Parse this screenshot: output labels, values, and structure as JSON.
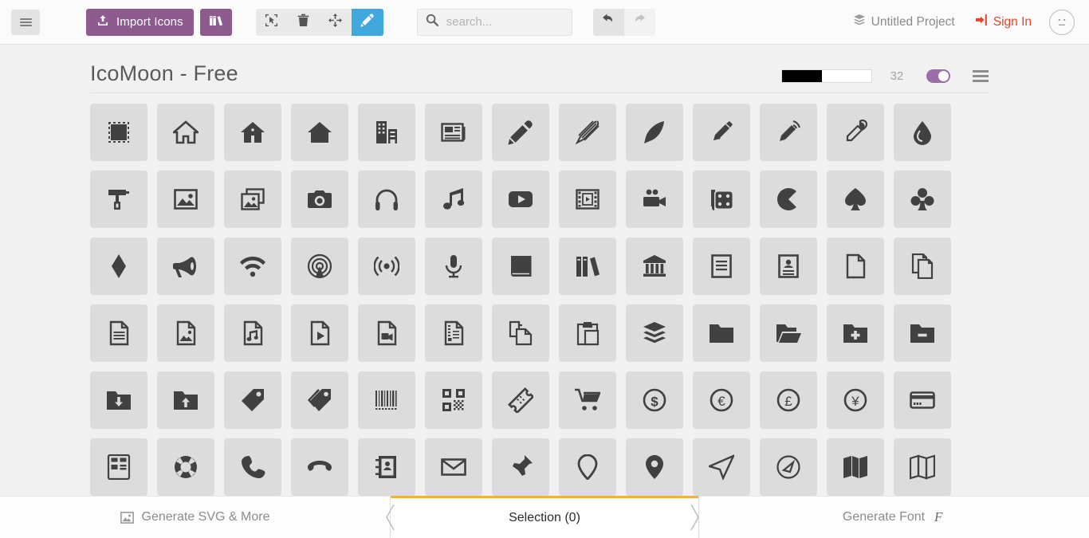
{
  "topbar": {
    "menu_button": "menu-icon",
    "import_label": "Import Icons",
    "library_label": "library-icon",
    "tools": [
      {
        "name": "select-tool",
        "icon": "cursor-select-icon",
        "active": false
      },
      {
        "name": "delete-tool",
        "icon": "trash-icon",
        "active": false
      },
      {
        "name": "move-tool",
        "icon": "move-icon",
        "active": false
      },
      {
        "name": "edit-tool",
        "icon": "pencil-icon",
        "active": true
      }
    ],
    "search": {
      "value": "",
      "placeholder": "search..."
    },
    "undo_label": "undo-icon",
    "redo_label": "redo-icon",
    "project_label": "Untitled Project",
    "signin_label": "Sign In",
    "avatar_label": "user-avatar"
  },
  "set": {
    "title": "IcoMoon - Free",
    "size_value": "32",
    "size_percent": 45,
    "toggle_on": true,
    "menu_label": "set-menu-icon"
  },
  "colors": {
    "accent_purple": "#8e5b8e",
    "accent_blue": "#41a8dd",
    "accent_red": "#e8442a",
    "accent_orange": "#f5ae42",
    "icon_cell_bg": "#dcdcdc",
    "icon_fill": "#414141",
    "page_bg": "#f1f1f1"
  },
  "bottombar": {
    "left_label": "Generate SVG & More",
    "left_icon": "image-icon",
    "center_label": "Selection (0)",
    "right_label": "Generate Font",
    "right_icon": "font-f-icon"
  },
  "icons": [
    [
      {
        "name": "selection-icon"
      },
      {
        "name": "home-icon"
      },
      {
        "name": "home2-icon"
      },
      {
        "name": "home3-icon"
      },
      {
        "name": "office-icon"
      },
      {
        "name": "newspaper-icon"
      },
      {
        "name": "pencil-icon"
      },
      {
        "name": "pencil2-icon"
      },
      {
        "name": "quill-icon"
      },
      {
        "name": "pen-icon"
      },
      {
        "name": "blog-icon"
      },
      {
        "name": "eyedropper-icon"
      },
      {
        "name": "droplet-icon"
      }
    ],
    [
      {
        "name": "paint-format-icon"
      },
      {
        "name": "image-icon"
      },
      {
        "name": "images-icon"
      },
      {
        "name": "camera-icon"
      },
      {
        "name": "headphones-icon"
      },
      {
        "name": "music-icon"
      },
      {
        "name": "play-icon"
      },
      {
        "name": "film-icon"
      },
      {
        "name": "video-camera-icon"
      },
      {
        "name": "dice-icon"
      },
      {
        "name": "pacman-icon"
      },
      {
        "name": "spades-icon"
      },
      {
        "name": "clubs-icon"
      }
    ],
    [
      {
        "name": "diamonds-icon"
      },
      {
        "name": "bullhorn-icon"
      },
      {
        "name": "connection-icon"
      },
      {
        "name": "podcast-icon"
      },
      {
        "name": "feed-icon"
      },
      {
        "name": "mic-icon"
      },
      {
        "name": "book-icon"
      },
      {
        "name": "books-icon"
      },
      {
        "name": "library-icon"
      },
      {
        "name": "file-text-icon"
      },
      {
        "name": "profile-icon"
      },
      {
        "name": "file-empty-icon"
      },
      {
        "name": "files-empty-icon"
      }
    ],
    [
      {
        "name": "file-text2-icon"
      },
      {
        "name": "file-picture-icon"
      },
      {
        "name": "file-music-icon"
      },
      {
        "name": "file-play-icon"
      },
      {
        "name": "file-video-icon"
      },
      {
        "name": "file-zip-icon"
      },
      {
        "name": "copy-icon"
      },
      {
        "name": "paste-icon"
      },
      {
        "name": "stack-icon"
      },
      {
        "name": "folder-icon"
      },
      {
        "name": "folder-open-icon"
      },
      {
        "name": "folder-plus-icon"
      },
      {
        "name": "folder-minus-icon"
      }
    ],
    [
      {
        "name": "folder-download-icon"
      },
      {
        "name": "folder-upload-icon"
      },
      {
        "name": "price-tag-icon"
      },
      {
        "name": "price-tags-icon"
      },
      {
        "name": "barcode-icon"
      },
      {
        "name": "qrcode-icon"
      },
      {
        "name": "ticket-icon"
      },
      {
        "name": "cart-icon"
      },
      {
        "name": "coin-dollar-icon"
      },
      {
        "name": "coin-euro-icon"
      },
      {
        "name": "coin-pound-icon"
      },
      {
        "name": "coin-yen-icon"
      },
      {
        "name": "credit-card-icon"
      }
    ],
    [
      {
        "name": "calculator-icon"
      },
      {
        "name": "lifebuoy-icon"
      },
      {
        "name": "phone-icon"
      },
      {
        "name": "phone-hang-up-icon"
      },
      {
        "name": "address-book-icon"
      },
      {
        "name": "envelop-icon"
      },
      {
        "name": "pushpin-icon"
      },
      {
        "name": "location-icon"
      },
      {
        "name": "location2-icon"
      },
      {
        "name": "compass-icon"
      },
      {
        "name": "compass2-icon"
      },
      {
        "name": "map-icon"
      },
      {
        "name": "map2-icon"
      }
    ]
  ]
}
